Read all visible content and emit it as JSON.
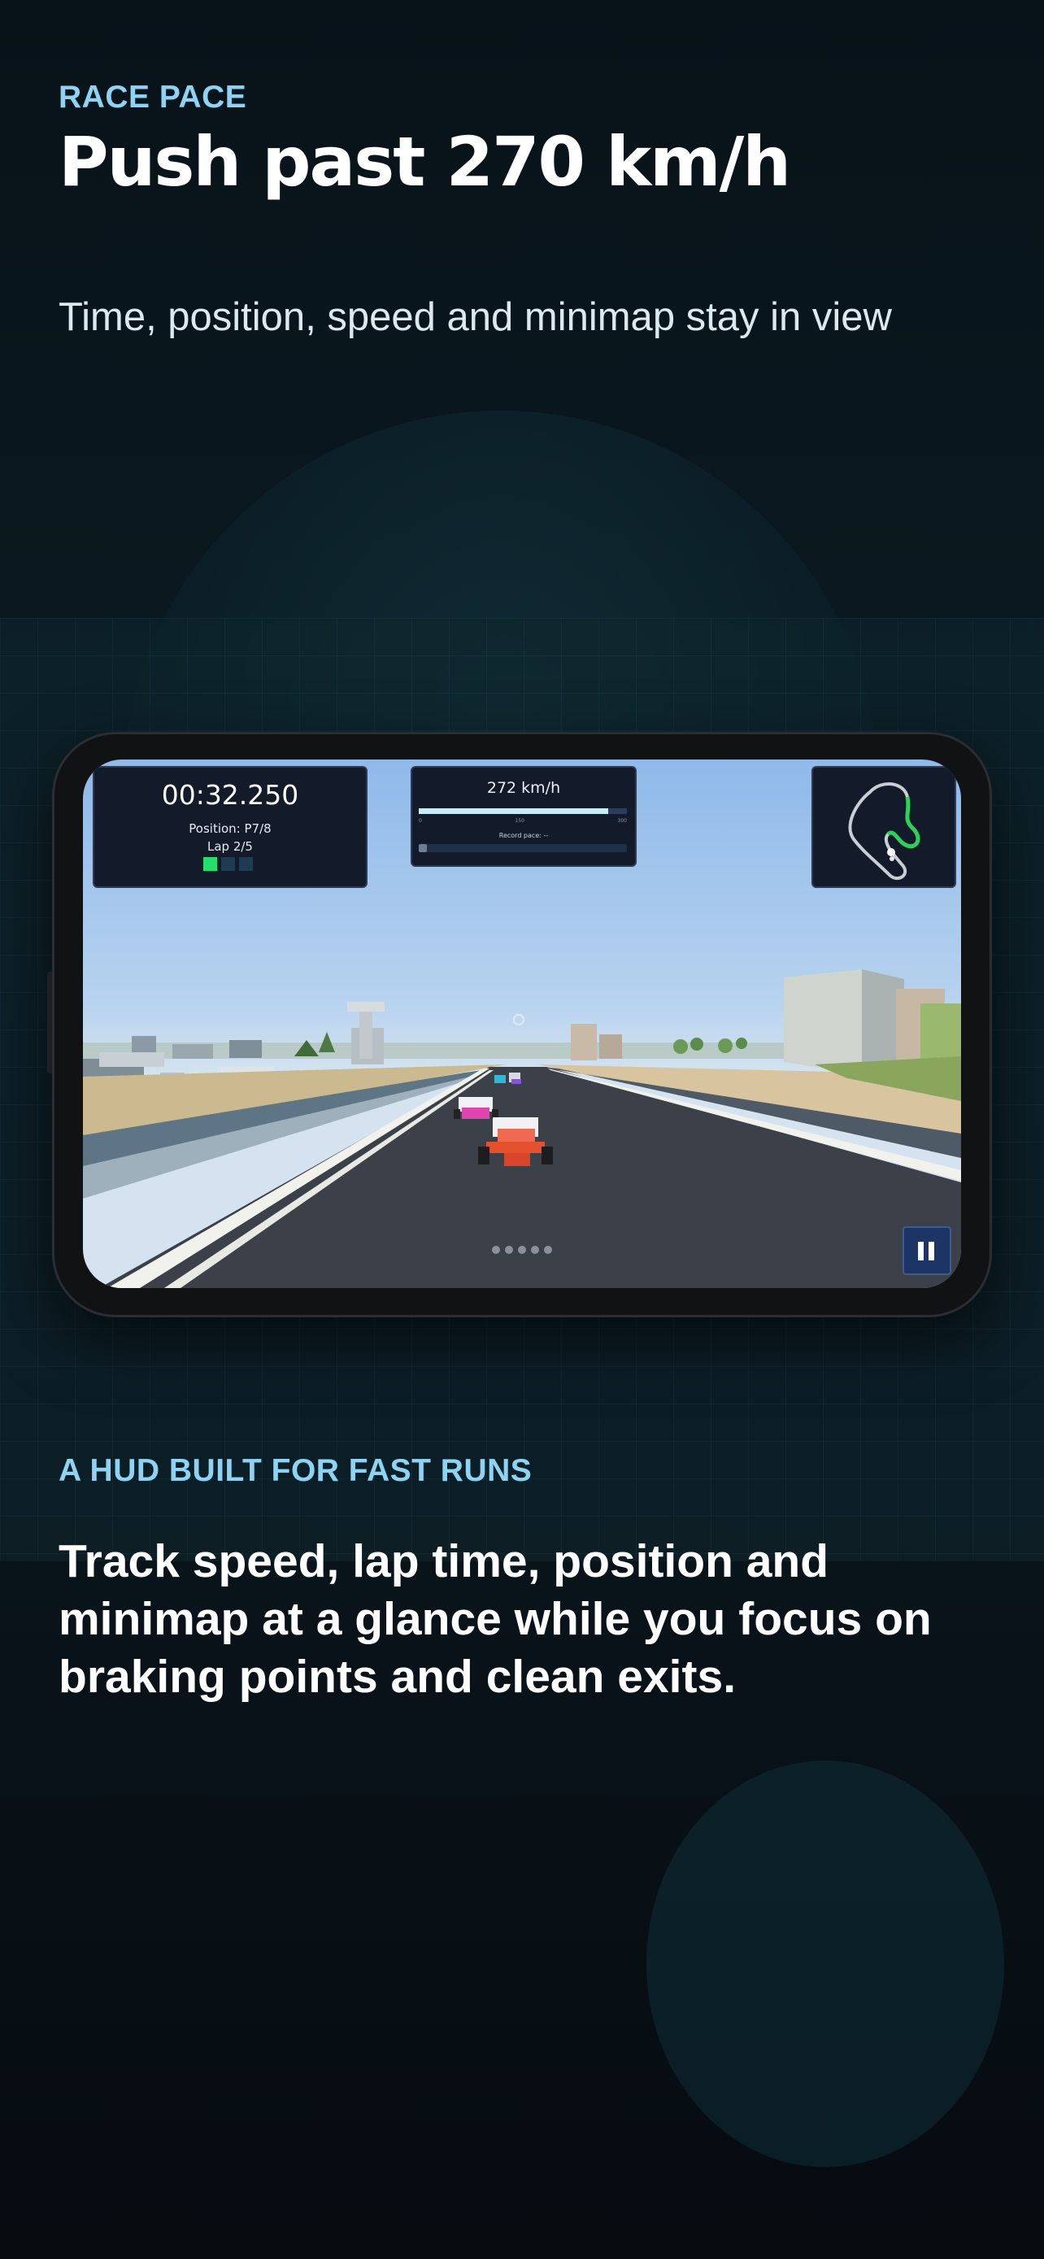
{
  "promo": {
    "eyebrow": "RACE PACE",
    "headline": "Push past 270 km/h",
    "subline": "Time, position, speed and minimap stay in view",
    "eyebrow2": "A HUD BUILT FOR FAST RUNS",
    "body": "Track speed, lap time, position and minimap at a glance while you focus on braking points and clean exits."
  },
  "hud": {
    "timer": "00:32.250",
    "position": "Position: P7/8",
    "lap": "Lap 2/5",
    "laps_completed": 1,
    "laps_segments": 3,
    "speed": "272 km/h",
    "speed_fraction": 0.91,
    "speed_ticks": [
      "0",
      "150",
      "300"
    ],
    "record_label": "Record pace: --",
    "record_fraction": 0.04
  },
  "carousel": {
    "pages": 5
  },
  "colors": {
    "accent": "#8dd3f4",
    "lap_done": "#23e06a",
    "minimap_route": "#2fd05a",
    "car_player": "#e4512c"
  },
  "icons": {
    "pause": "pause-icon"
  }
}
